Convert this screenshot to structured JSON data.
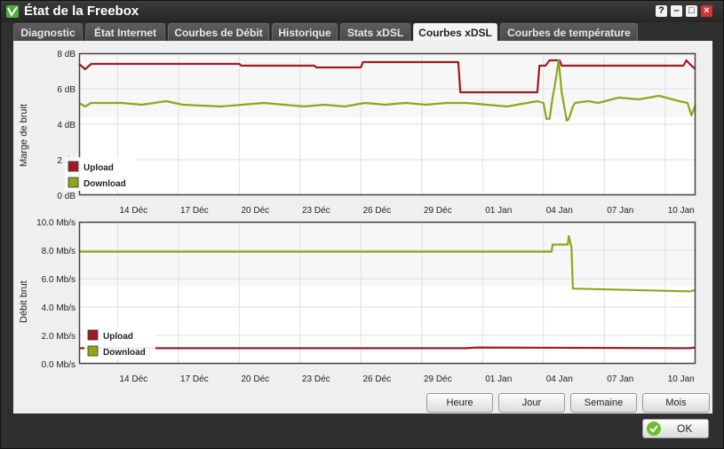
{
  "window": {
    "title": "État de la Freebox"
  },
  "tabs": [
    {
      "label": "Diagnostic",
      "active": false
    },
    {
      "label": "État Internet",
      "active": false
    },
    {
      "label": "Courbes de Débit",
      "active": false
    },
    {
      "label": "Historique",
      "active": false
    },
    {
      "label": "Stats xDSL",
      "active": false
    },
    {
      "label": "Courbes xDSL",
      "active": true
    },
    {
      "label": "Courbes de température",
      "active": false
    }
  ],
  "colors": {
    "upload": "#a01a26",
    "download": "#8fa61a",
    "accent": "#4cae3a"
  },
  "chart_data": [
    {
      "type": "line",
      "ylabel": "Marge de bruit",
      "ylim": [
        0,
        8
      ],
      "ytick_labels": [
        "0 dB",
        "2 dB",
        "4 dB",
        "6 dB",
        "8 dB"
      ],
      "ytick_values": [
        0,
        2,
        4,
        6,
        8
      ],
      "xtick_labels": [
        "14 Déc",
        "17 Déc",
        "20 Déc",
        "23 Déc",
        "26 Déc",
        "29 Déc",
        "01 Jan",
        "04 Jan",
        "07 Jan",
        "10 Jan"
      ],
      "xtick_days": [
        2,
        5,
        8,
        11,
        14,
        17,
        20,
        23,
        26,
        29
      ],
      "xlim_days": [
        -0.6,
        29.8
      ],
      "legend_placement": "bottom-left",
      "series": [
        {
          "name": "Upload",
          "x_days": [
            -0.6,
            -0.3,
            0,
            7.3,
            7.4,
            11,
            11.1,
            13.3,
            13.4,
            15.5,
            18.1,
            18.2,
            22,
            22.1,
            22.4,
            22.6,
            23.1,
            23.2,
            24.5,
            29.2,
            29.35,
            29.5,
            29.8
          ],
          "values": [
            7.4,
            7.1,
            7.4,
            7.4,
            7.3,
            7.3,
            7.2,
            7.2,
            7.5,
            7.5,
            7.5,
            5.8,
            5.8,
            7.3,
            7.3,
            7.6,
            7.6,
            7.3,
            7.3,
            7.3,
            7.6,
            7.4,
            7.1
          ]
        },
        {
          "name": "Download",
          "x_days": [
            -0.6,
            -0.3,
            0,
            1.5,
            2.5,
            3.7,
            4.5,
            6.4,
            8.5,
            9.5,
            10.5,
            11.5,
            12.5,
            13.5,
            14.5,
            15.5,
            16.5,
            17.5,
            18.5,
            19.5,
            20.5,
            21.5,
            22,
            22.3,
            22.45,
            22.6,
            22.75,
            22.85,
            23.05,
            23.2,
            23.45,
            23.55,
            23.75,
            23.85,
            24.5,
            25,
            26,
            27,
            28,
            29,
            29.4,
            29.6,
            29.8
          ],
          "values": [
            5.2,
            5.0,
            5.2,
            5.2,
            5.1,
            5.3,
            5.1,
            5.0,
            5.2,
            5.1,
            5.0,
            5.1,
            5.0,
            5.2,
            5.1,
            5.2,
            5.1,
            5.2,
            5.2,
            5.1,
            5.0,
            5.2,
            5.3,
            5.2,
            4.3,
            4.3,
            5.5,
            6.1,
            7.6,
            5.8,
            4.2,
            4.3,
            5.0,
            5.2,
            5.3,
            5.2,
            5.5,
            5.4,
            5.6,
            5.3,
            5.2,
            4.5,
            5.1
          ]
        }
      ]
    },
    {
      "type": "line",
      "ylabel": "Débit brut",
      "ylim": [
        0,
        10
      ],
      "ytick_labels": [
        "0.0 Mb/s",
        "2.0 Mb/s",
        "4.0 Mb/s",
        "6.0 Mb/s",
        "8.0 Mb/s",
        "10.0 Mb/s"
      ],
      "ytick_values": [
        0,
        2,
        4,
        6,
        8,
        10
      ],
      "xtick_labels": [
        "14 Déc",
        "17 Déc",
        "20 Déc",
        "23 Déc",
        "26 Déc",
        "29 Déc",
        "01 Jan",
        "04 Jan",
        "07 Jan",
        "10 Jan"
      ],
      "xtick_days": [
        2,
        5,
        8,
        11,
        14,
        17,
        20,
        23,
        26,
        29
      ],
      "xlim_days": [
        -0.6,
        29.8
      ],
      "legend_placement": "bottom-left",
      "series": [
        {
          "name": "Upload",
          "x_days": [
            -0.6,
            18.5,
            19,
            29.5,
            29.8
          ],
          "values": [
            1.1,
            1.1,
            1.15,
            1.1,
            1.15
          ]
        },
        {
          "name": "Download",
          "x_days": [
            -0.6,
            22.7,
            22.75,
            23.5,
            23.55,
            23.68,
            23.75,
            29.5,
            29.8
          ],
          "values": [
            7.9,
            7.9,
            8.4,
            8.4,
            9.0,
            8.2,
            5.3,
            5.1,
            5.2
          ]
        }
      ]
    }
  ],
  "range_buttons": {
    "heure": "Heure",
    "jour": "Jour",
    "semaine": "Semaine",
    "mois": "Mois"
  },
  "ok_button": {
    "label": "OK"
  }
}
